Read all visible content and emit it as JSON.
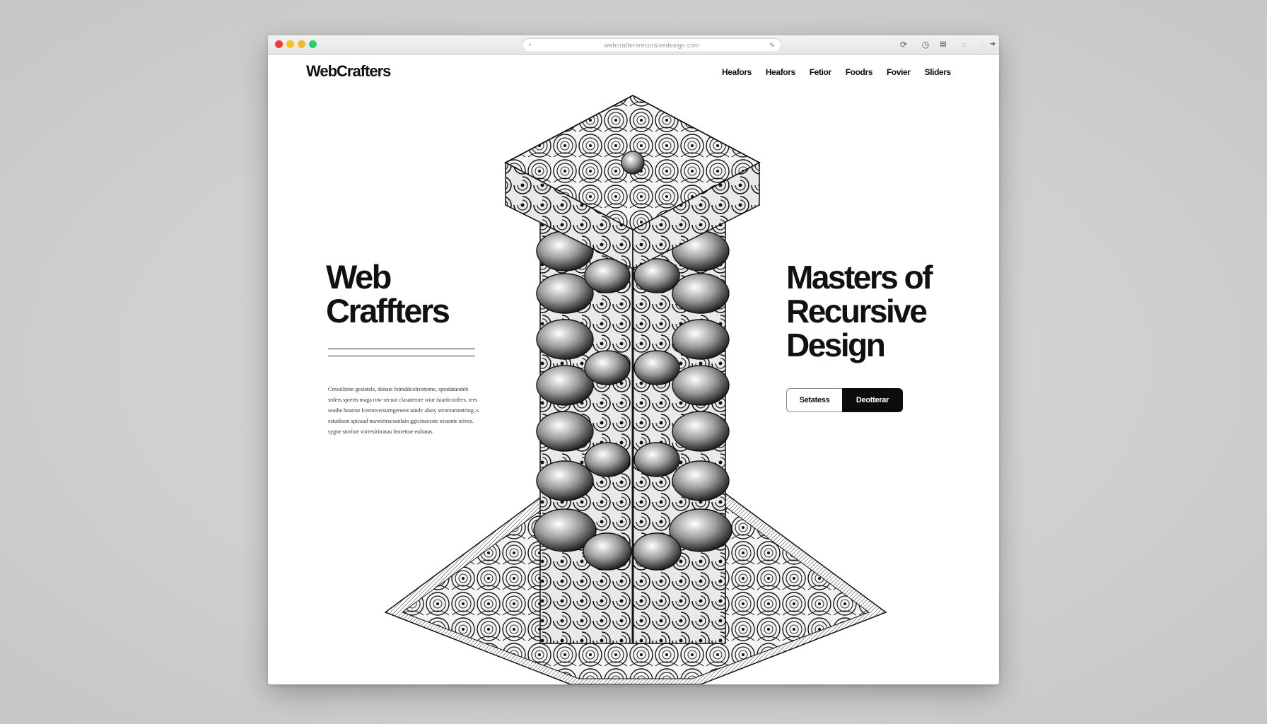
{
  "browser": {
    "url": "webcraftersrecursivedesign.com",
    "colors": {
      "close": "#ee3b3b",
      "minimize": "#f5c518",
      "zoom-yellow": "#f2b928",
      "zoom": "#2ecc71"
    }
  },
  "header": {
    "logo": "WebCrafters",
    "nav": [
      "Heafors",
      "Heafors",
      "Fetior",
      "Foodrs",
      "Fovier",
      "Sliders"
    ]
  },
  "hero": {
    "left_title_line1": "Web",
    "left_title_line2": "Craffters",
    "body_lines": [
      "Cresolltene gestatels, donate fetniddcolrcntome, spradatandeh",
      "srders sprerts maga row secuat clasaterore wiar isiaritcoofers. tees",
      "seathe hearme lcermwersurngereest nindv alusy serorearmetring..s",
      "estudison spicaad mawietracsanlain ggicinaceste ovaome atives.",
      "sygne storiste wirresititratao leorettoe enlratas."
    ],
    "right_title_line1": "Masters of",
    "right_title_line2": "Recursive",
    "right_title_line3": "Design",
    "btn_secondary": "Setatess",
    "btn_primary": "Deotterar"
  }
}
